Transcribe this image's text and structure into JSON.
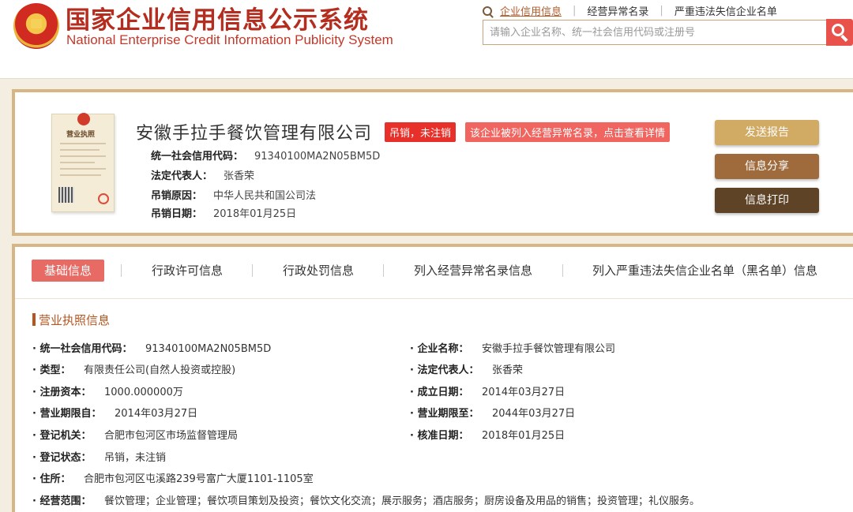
{
  "header": {
    "title": "国家企业信用信息公示系统",
    "subtitle": "National Enterprise Credit Information Publicity System",
    "links": [
      "企业信用信息",
      "经营异常名录",
      "严重违法失信企业名单"
    ],
    "search_placeholder": "请输入企业名称、统一社会信用代码或注册号"
  },
  "company": {
    "name": "安徽手拉手餐饮管理有限公司",
    "status_badge": "吊销，未注销",
    "abnormal_badge": "该企业被列入经营异常名录，点击查看详情",
    "rows": [
      {
        "label": "统一社会信用代码：",
        "value": "91340100MA2N05BM5D"
      },
      {
        "label": "法定代表人：",
        "value": "张香荣"
      },
      {
        "label": "吊销原因：",
        "value": "中华人民共和国公司法"
      },
      {
        "label": "吊销日期：",
        "value": "2018年01月25日"
      }
    ],
    "license_title": "营业执照",
    "buttons": [
      "发送报告",
      "信息分享",
      "信息打印"
    ]
  },
  "tabs": [
    "基础信息",
    "行政许可信息",
    "行政处罚信息",
    "列入经营异常名录信息",
    "列入严重违法失信企业名单（黑名单）信息"
  ],
  "section": {
    "title": "营业执照信息",
    "fields": [
      {
        "label": "统一社会信用代码：",
        "value": "91340100MA2N05BM5D"
      },
      {
        "label": "企业名称：",
        "value": "安徽手拉手餐饮管理有限公司"
      },
      {
        "label": "类型：",
        "value": "有限责任公司(自然人投资或控股)"
      },
      {
        "label": "法定代表人：",
        "value": "张香荣"
      },
      {
        "label": "注册资本：",
        "value": "1000.000000万"
      },
      {
        "label": "成立日期：",
        "value": "2014年03月27日"
      },
      {
        "label": "营业期限自：",
        "value": "2014年03月27日"
      },
      {
        "label": "营业期限至：",
        "value": "2044年03月27日"
      },
      {
        "label": "登记机关：",
        "value": "合肥市包河区市场监督管理局"
      },
      {
        "label": "核准日期：",
        "value": "2018年01月25日"
      },
      {
        "label": "登记状态：",
        "value": "吊销，未注销"
      },
      {
        "label": "住所：",
        "value": "合肥市包河区屯溪路239号富广大厦1101-1105室"
      },
      {
        "label": "经营范围：",
        "value": "餐饮管理；企业管理；餐饮项目策划及投资；餐饮文化交流；展示服务；酒店服务；厨房设备及用品的销售；投资管理；礼仪服务。"
      }
    ]
  }
}
